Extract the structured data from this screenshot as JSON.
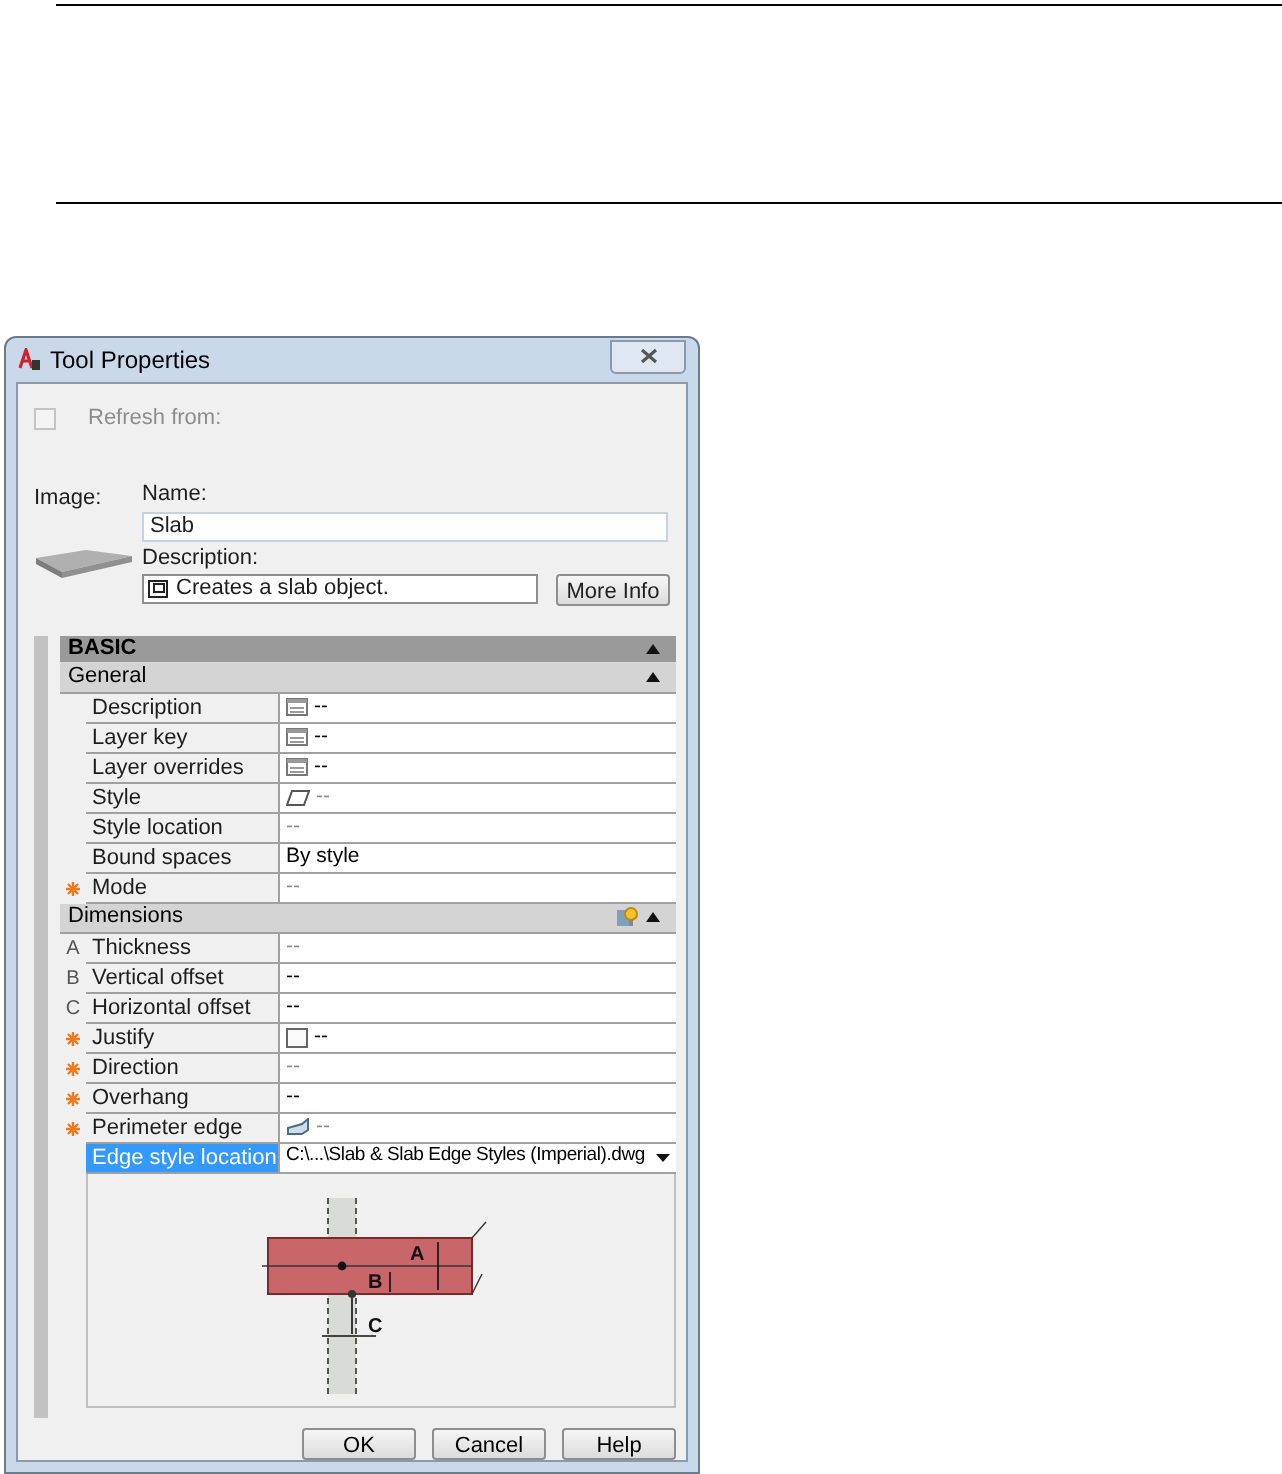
{
  "window": {
    "title": "Tool Properties"
  },
  "refresh": {
    "label": "Refresh from:",
    "checked": false,
    "disabled": true
  },
  "image_label": "Image:",
  "name": {
    "label": "Name:",
    "value": "Slab"
  },
  "description": {
    "label": "Description:",
    "value": "Creates a slab object."
  },
  "more_info_button": "More Info",
  "properties": {
    "title": "BASIC",
    "expanded": true,
    "sections": [
      {
        "title": "General",
        "expanded": true,
        "tip_icon": false,
        "rows": [
          {
            "label": "Description",
            "value": "--",
            "kind": "table",
            "dimmed": false,
            "required": false,
            "selected": false
          },
          {
            "label": "Layer key",
            "value": "--",
            "kind": "table",
            "dimmed": false,
            "required": false,
            "selected": false
          },
          {
            "label": "Layer overrides",
            "value": "--",
            "kind": "table",
            "dimmed": false,
            "required": false,
            "selected": false
          },
          {
            "label": "Style",
            "value": "--",
            "kind": "style",
            "dimmed": true,
            "required": false,
            "selected": false
          },
          {
            "label": "Style location",
            "value": "--",
            "dimmed": true,
            "required": false,
            "selected": false
          },
          {
            "label": "Bound spaces",
            "value": "By style",
            "dimmed": false,
            "required": false,
            "selected": false
          },
          {
            "label": "Mode",
            "value": "--",
            "dimmed": true,
            "required": true,
            "selected": false
          }
        ]
      },
      {
        "title": "Dimensions",
        "expanded": true,
        "tip_icon": true,
        "rows": [
          {
            "marker": "A",
            "label": "Thickness",
            "value": "--",
            "dimmed": true,
            "required": false,
            "selected": false
          },
          {
            "marker": "B",
            "label": "Vertical offset",
            "value": "--",
            "dimmed": false,
            "required": false,
            "selected": false
          },
          {
            "marker": "C",
            "label": "Horizontal offset",
            "value": "--",
            "dimmed": false,
            "required": false,
            "selected": false
          },
          {
            "label": "Justify",
            "value": "--",
            "kind": "toggle",
            "dimmed": false,
            "required": true,
            "selected": false
          },
          {
            "label": "Direction",
            "value": "--",
            "dimmed": true,
            "required": true,
            "selected": false
          },
          {
            "label": "Overhang",
            "value": "--",
            "dimmed": false,
            "required": true,
            "selected": false
          },
          {
            "label": "Perimeter edge",
            "value": "--",
            "kind": "edge",
            "dimmed": true,
            "required": true,
            "selected": false
          },
          {
            "label": "Edge style location",
            "value": "C:\\...\\Slab & Slab Edge Styles (Imperial).dwg",
            "dimmed": false,
            "required": false,
            "selected": true,
            "dropdown": true
          }
        ]
      }
    ]
  },
  "diagram_labels": [
    "A",
    "B",
    "C"
  ],
  "buttons": [
    "OK",
    "Cancel",
    "Help"
  ]
}
